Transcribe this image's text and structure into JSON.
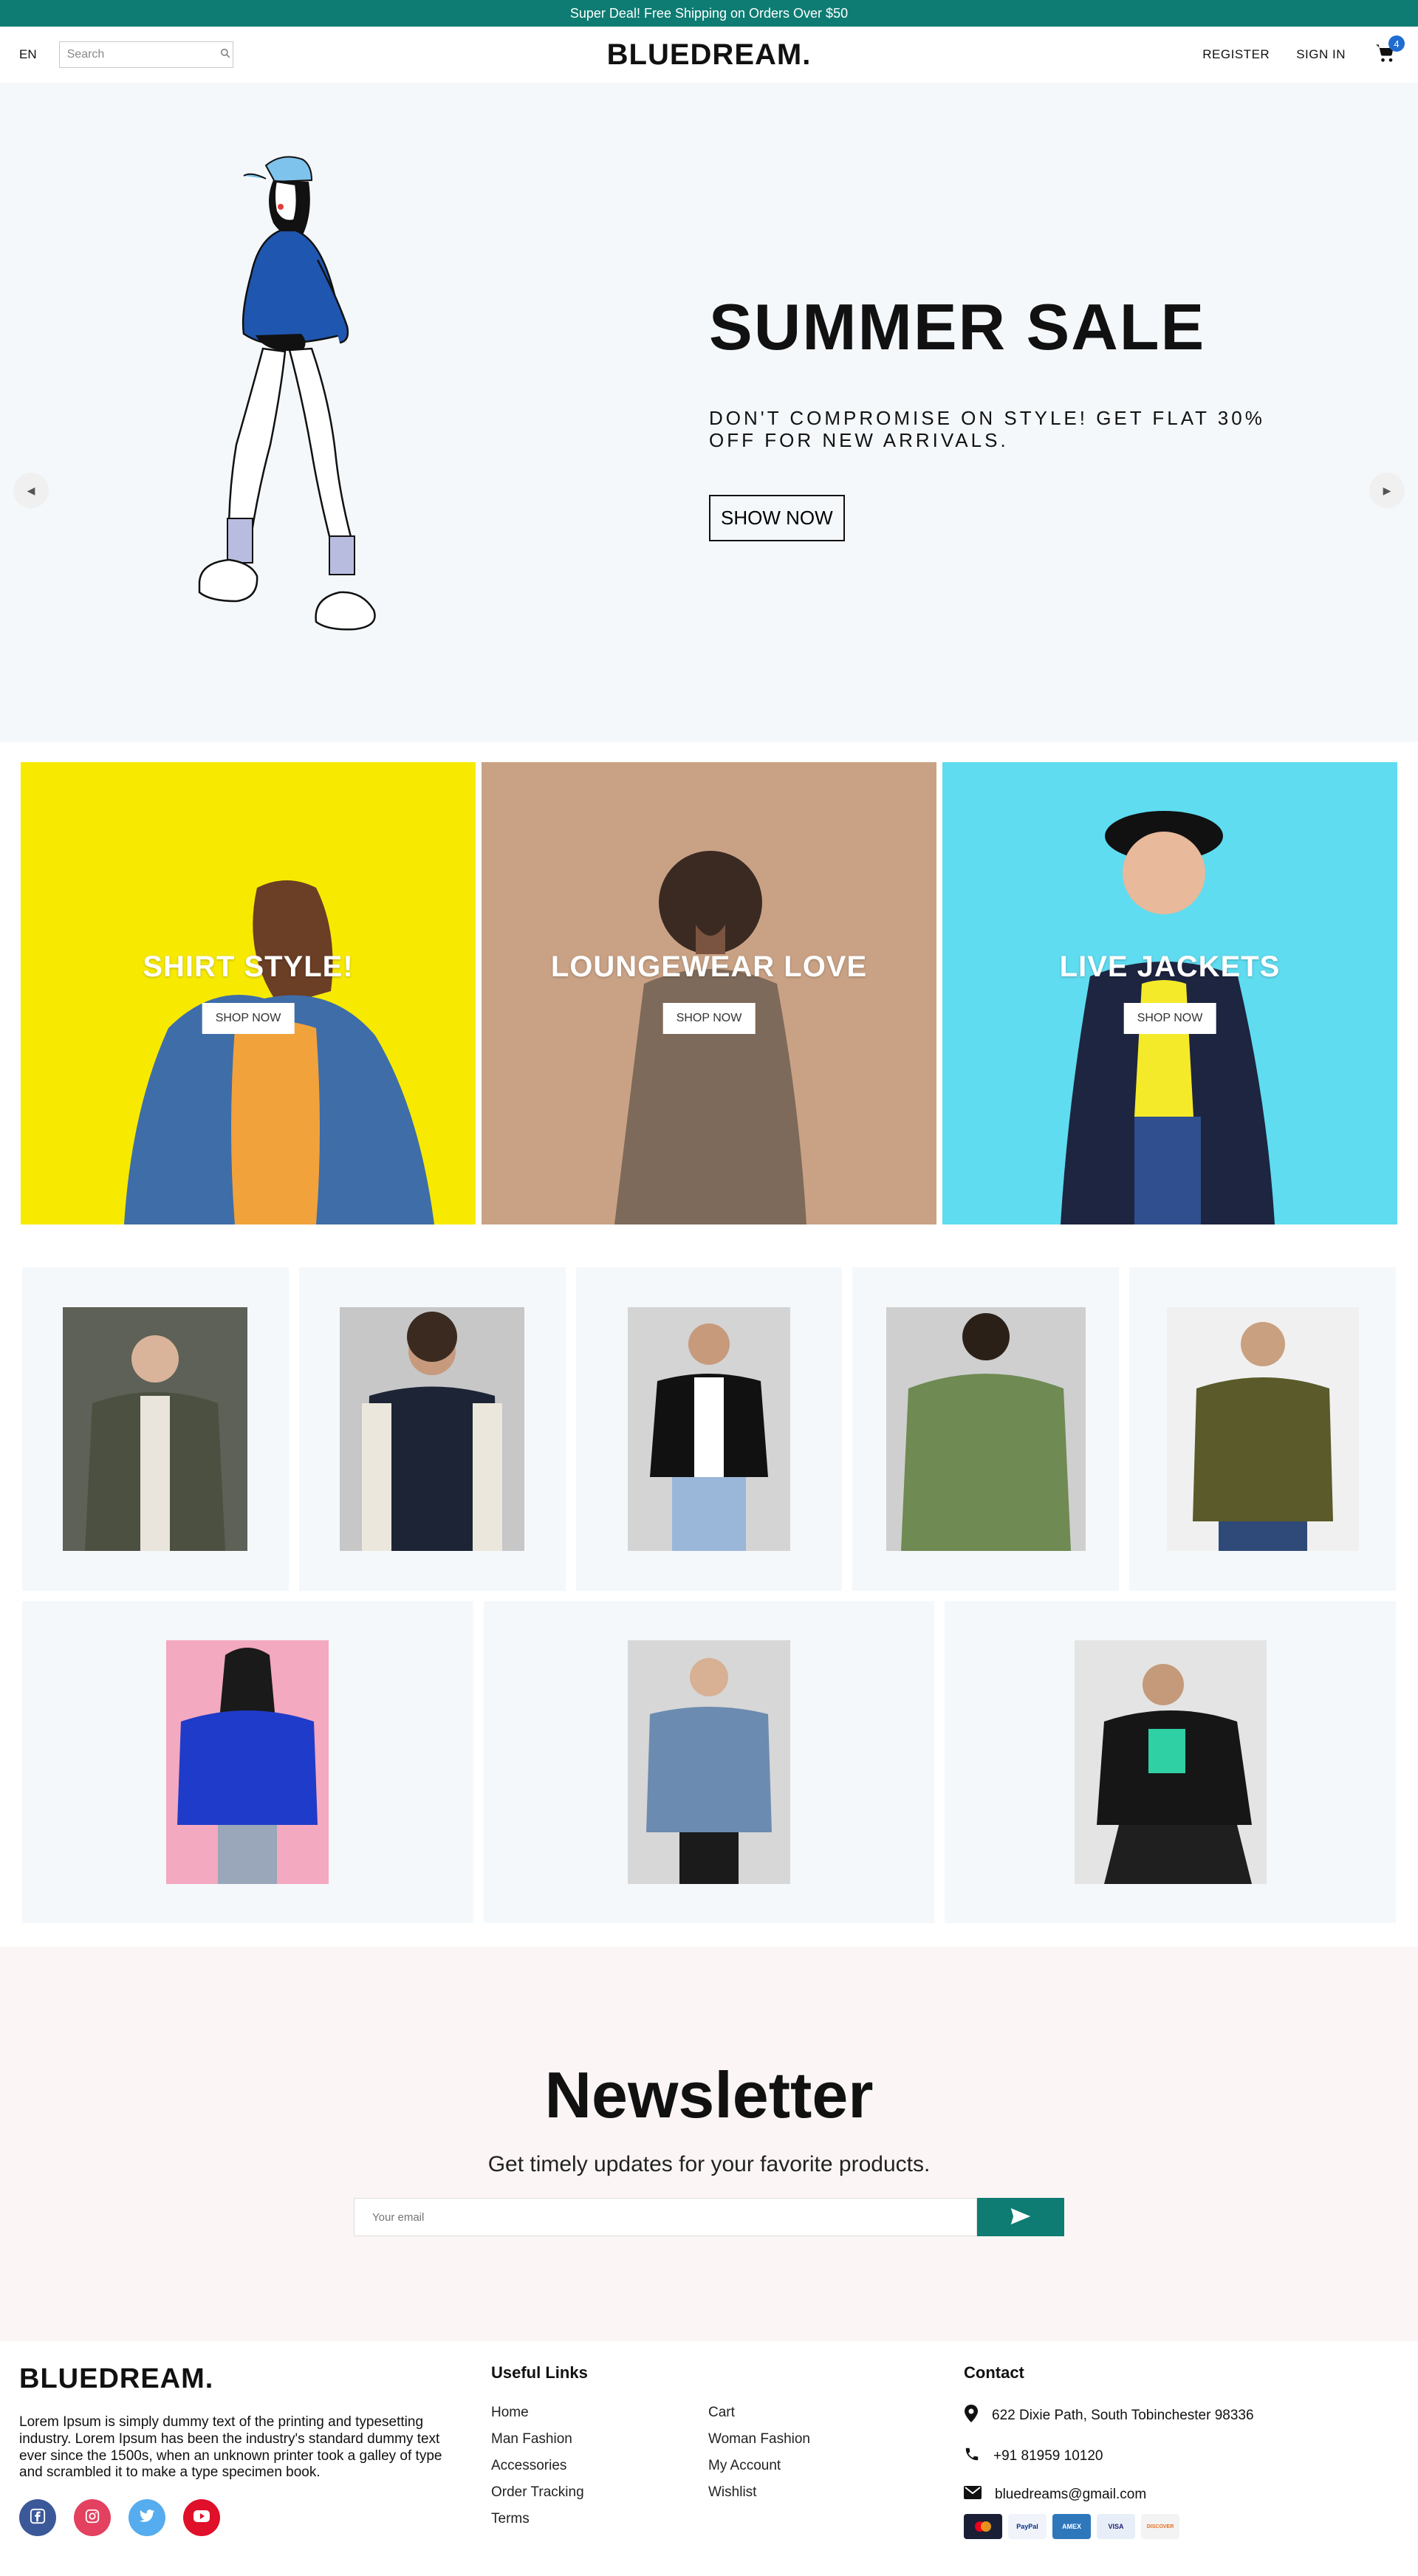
{
  "announcement": "Super Deal! Free Shipping on Orders Over $50",
  "nav": {
    "language": "EN",
    "search_placeholder": "Search",
    "logo": "BLUEDREAM.",
    "register": "REGISTER",
    "sign_in": "SIGN IN",
    "cart_count": "4"
  },
  "hero": {
    "title": "SUMMER SALE",
    "subtitle": "DON'T COMPROMISE ON STYLE! GET FLAT 30% OFF FOR NEW ARRIVALS.",
    "button": "SHOW NOW"
  },
  "categories": [
    {
      "title": "SHIRT STYLE!",
      "button": "SHOP NOW",
      "color": "#f7ea00"
    },
    {
      "title": "LOUNGEWEAR LOVE",
      "button": "SHOP NOW",
      "color": "#c9a285"
    },
    {
      "title": "LIVE JACKETS",
      "button": "SHOP NOW",
      "color": "#5fdcf0"
    }
  ],
  "newsletter": {
    "title": "Newsletter",
    "subtitle": "Get timely updates for your favorite products.",
    "placeholder": "Your email"
  },
  "footer": {
    "logo": "BLUEDREAM.",
    "description": "Lorem Ipsum is simply dummy text of the printing and typesetting industry. Lorem Ipsum has been the industry's standard dummy text ever since the 1500s, when an unknown printer took a galley of type and scrambled it to make a type specimen book.",
    "useful_links_title": "Useful Links",
    "links": [
      "Home",
      "Cart",
      "Man Fashion",
      "Woman Fashion",
      "Accessories",
      "My Account",
      "Order Tracking",
      "Wishlist",
      "Terms"
    ],
    "contact_title": "Contact",
    "address": "622 Dixie Path, South Tobinchester 98336",
    "phone": "+91 81959 10120",
    "email": "bluedreams@gmail.com",
    "payments": [
      "MasterCard",
      "PayPal",
      "AMEX",
      "VISA",
      "DISCOVER"
    ]
  },
  "colors": {
    "accent": "#0e7c73",
    "hero_bg": "#f4f8fb",
    "newsletter_bg": "#fbf6f5"
  }
}
